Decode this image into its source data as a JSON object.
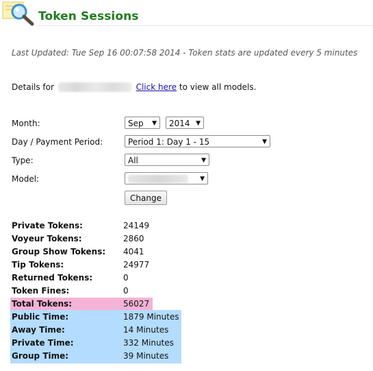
{
  "header": {
    "title": "Token Sessions"
  },
  "last_updated": "Last Updated: Tue Sep 16 00:07:58 2014 - Token stats are updated every 5 minutes",
  "details": {
    "prefix": "Details for",
    "link": "Click here",
    "suffix": "to view all models."
  },
  "form": {
    "month_label": "Month:",
    "month_value": "Sep",
    "year_value": "2014",
    "period_label": "Day / Payment Period:",
    "period_value": "Period 1: Day 1 - 15",
    "type_label": "Type:",
    "type_value": "All",
    "model_label": "Model:",
    "change_button": "Change"
  },
  "stats": [
    {
      "label": "Private Tokens:",
      "value": "24149"
    },
    {
      "label": "Voyeur Tokens:",
      "value": "2860"
    },
    {
      "label": "Group Show Tokens:",
      "value": "4041"
    },
    {
      "label": "Tip Tokens:",
      "value": "24977"
    },
    {
      "label": "Returned Tokens:",
      "value": "0"
    },
    {
      "label": "Token Fines:",
      "value": "0"
    },
    {
      "label": "Total Tokens:",
      "value": "56027"
    },
    {
      "label": "Public Time:",
      "value": "1879 Minutes"
    },
    {
      "label": "Away Time:",
      "value": "14 Minutes"
    },
    {
      "label": "Private Time:",
      "value": "332 Minutes"
    },
    {
      "label": "Group Time:",
      "value": "39 Minutes"
    }
  ],
  "colors": {
    "title": "#1f7a1f",
    "total_highlight": "#f4b3d6",
    "time_highlight": "#b3dcff"
  },
  "icons": {
    "header": "magnifier-icon"
  }
}
